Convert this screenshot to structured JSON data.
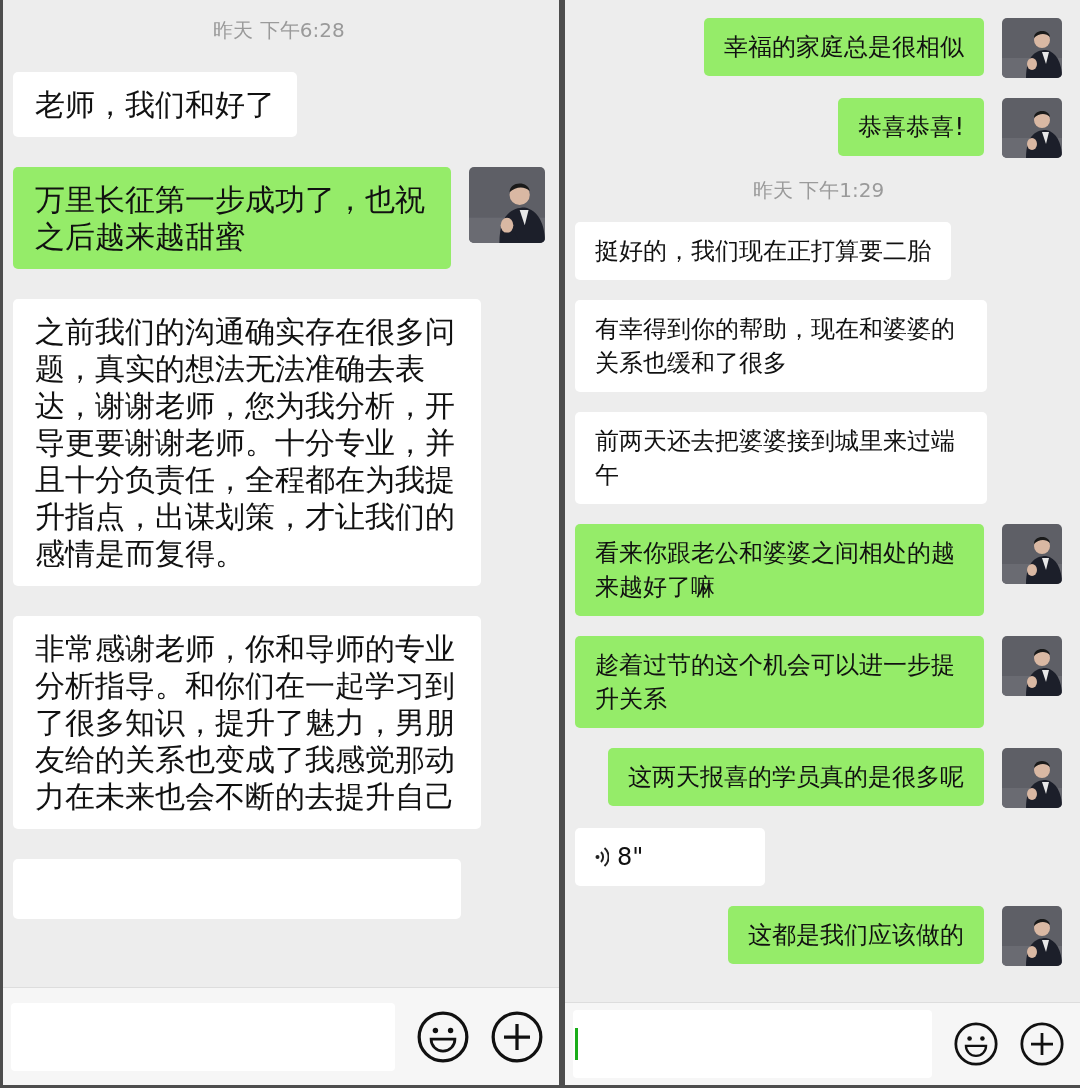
{
  "panels": [
    {
      "messages": [
        {
          "kind": "time",
          "text": "昨天 下午6:28"
        },
        {
          "kind": "text",
          "outgoing": false,
          "text": "老师，我们和好了"
        },
        {
          "kind": "text",
          "outgoing": true,
          "text": "万里长征第一步成功了，也祝之后越来越甜蜜"
        },
        {
          "kind": "text",
          "outgoing": false,
          "text": "之前我们的沟通确实存在很多问题，真实的想法无法准确去表达，谢谢老师，您为我分析，开导更要谢谢老师。十分专业，并且十分负责任，全程都在为我提升指点，出谋划策，才让我们的感情是而复得。"
        },
        {
          "kind": "text",
          "outgoing": false,
          "text": "非常感谢老师，你和导师的专业分析指导。和你们在一起学习到了很多知识，提升了魅力，男朋友给的关系也变成了我感觉那动力在未来也会不断的去提升自己"
        },
        {
          "kind": "cut",
          "outgoing": false
        }
      ],
      "input": {
        "focused": false
      }
    },
    {
      "messages": [
        {
          "kind": "text",
          "outgoing": true,
          "text": "幸福的家庭总是很相似"
        },
        {
          "kind": "text",
          "outgoing": true,
          "text": "恭喜恭喜!"
        },
        {
          "kind": "time",
          "text": "昨天 下午1:29"
        },
        {
          "kind": "text",
          "outgoing": false,
          "text": "挺好的，我们现在正打算要二胎"
        },
        {
          "kind": "text",
          "outgoing": false,
          "text": "有幸得到你的帮助，现在和婆婆的关系也缓和了很多"
        },
        {
          "kind": "text",
          "outgoing": false,
          "text": "前两天还去把婆婆接到城里来过端午"
        },
        {
          "kind": "text",
          "outgoing": true,
          "text": "看来你跟老公和婆婆之间相处的越来越好了嘛"
        },
        {
          "kind": "text",
          "outgoing": true,
          "text": "趁着过节的这个机会可以进一步提升关系"
        },
        {
          "kind": "text",
          "outgoing": true,
          "text": "这两天报喜的学员真的是很多呢"
        },
        {
          "kind": "voice",
          "outgoing": false,
          "text": "8\""
        },
        {
          "kind": "text",
          "outgoing": true,
          "text": "这都是我们应该做的"
        }
      ],
      "input": {
        "focused": true
      }
    }
  ]
}
